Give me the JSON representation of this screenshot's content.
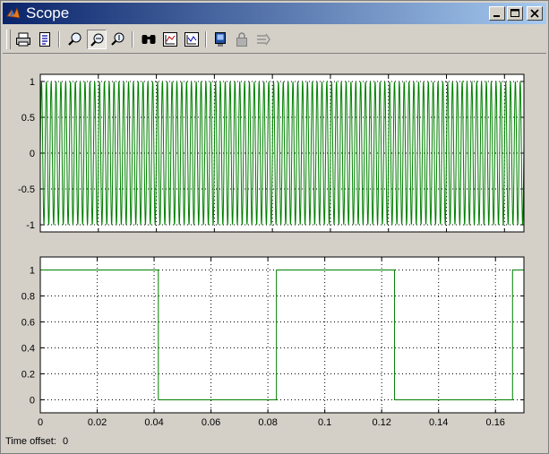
{
  "window": {
    "title": "Scope",
    "controls": [
      "minimize-icon",
      "maximize-icon",
      "close-icon"
    ]
  },
  "toolbar": {
    "buttons": [
      {
        "name": "print-button",
        "icon": "printer-icon"
      },
      {
        "name": "parameters-button",
        "icon": "parameters-icon"
      },
      {
        "name": "zoom-button",
        "icon": "zoom-icon"
      },
      {
        "name": "zoom-x-button",
        "icon": "zoom-x-icon",
        "pressed": true
      },
      {
        "name": "zoom-y-button",
        "icon": "zoom-y-icon"
      },
      {
        "name": "autoscale-button",
        "icon": "binoculars-icon"
      },
      {
        "name": "save-axes-button",
        "icon": "save-axes-icon"
      },
      {
        "name": "restore-axes-button",
        "icon": "restore-axes-icon"
      },
      {
        "name": "floating-scope-button",
        "icon": "floating-scope-icon"
      },
      {
        "name": "lock-axes-button",
        "icon": "lock-icon",
        "disabled": true
      },
      {
        "name": "signal-selection-button",
        "icon": "signal-selection-icon",
        "disabled": true
      }
    ]
  },
  "chart_data": [
    {
      "type": "line",
      "description_series": "fast sine oscillation between -1 and 1",
      "x_range": [
        0,
        0.1667
      ],
      "ylim": [
        -1.1,
        1.1
      ],
      "yticks": [
        "1",
        "0.5",
        "0",
        "-0.5",
        "-1"
      ],
      "ytick_values": [
        1,
        0.5,
        0,
        -0.5,
        -1
      ],
      "xticks_count": 9,
      "grid": true,
      "series": [
        {
          "color": "#008000",
          "frequency_hz": 600,
          "amplitude": 1
        }
      ]
    },
    {
      "type": "line",
      "x_range": [
        0,
        0.17
      ],
      "ylim": [
        -0.1,
        1.1
      ],
      "xticks": [
        "0",
        "0.02",
        "0.04",
        "0.06",
        "0.08",
        "0.1",
        "0.12",
        "0.14",
        "0.16"
      ],
      "xtick_values": [
        0,
        0.02,
        0.04,
        0.06,
        0.08,
        0.1,
        0.12,
        0.14,
        0.16
      ],
      "yticks": [
        "1",
        "0.8",
        "0.6",
        "0.4",
        "0.2",
        "0"
      ],
      "ytick_values": [
        1,
        0.8,
        0.6,
        0.4,
        0.2,
        0
      ],
      "grid": true,
      "series": [
        {
          "color": "#008000",
          "points": [
            [
              0,
              1
            ],
            [
              0.0415,
              1
            ],
            [
              0.0415,
              0
            ],
            [
              0.083,
              0
            ],
            [
              0.083,
              1
            ],
            [
              0.1245,
              1
            ],
            [
              0.1245,
              0
            ],
            [
              0.166,
              0
            ],
            [
              0.166,
              1
            ],
            [
              0.17,
              1
            ]
          ]
        }
      ]
    }
  ],
  "status": {
    "label": "Time offset:",
    "value": "0"
  },
  "colors": {
    "titlebar_start": "#0a246a",
    "titlebar_end": "#a6caf0",
    "plot_line": "#008000",
    "background": "#d4d0c8"
  }
}
